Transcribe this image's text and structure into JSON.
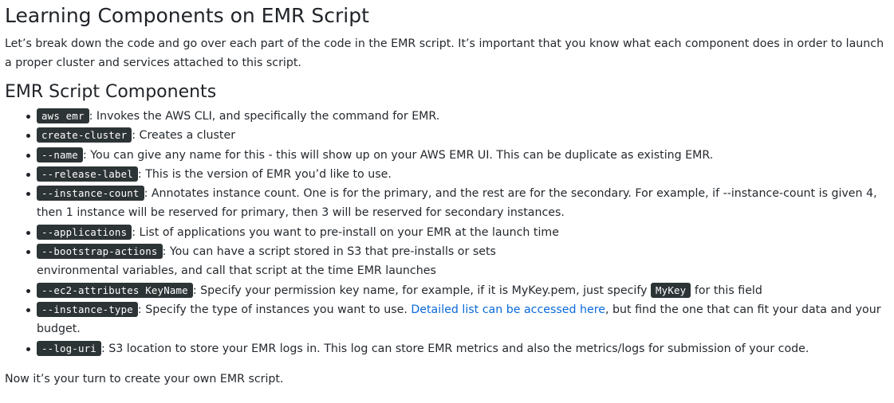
{
  "title": "Learning Components on EMR Script",
  "intro": "Let’s break down the code and go over each part of the code in the EMR script. It’s important that you know what each component does in order to launch a proper cluster and services attached to this script.",
  "section_title": "EMR Script Components",
  "items": [
    {
      "code": "aws emr",
      "text": ": Invokes the AWS CLI, and specifically the command for EMR."
    },
    {
      "code": "create-cluster",
      "text": ": Creates a cluster"
    },
    {
      "code": "--name",
      "text": ": You can give any name for this - this will show up on your AWS EMR UI. This can be duplicate as existing EMR."
    },
    {
      "code": "--release-label",
      "text": ": This is the version of EMR you’d like to use."
    },
    {
      "code": "--instance-count",
      "text": ": Annotates instance count. One is for the primary, and the rest are for the secondary. For example, if --instance-count is given 4, then 1 instance will be reserved for primary, then 3 will be reserved for secondary instances."
    },
    {
      "code": "--applications",
      "text": ": List of applications you want to pre-install on your EMR at the launch time"
    },
    {
      "code": "--bootstrap-actions",
      "text": ": You can have a script stored in S3 that pre-installs or sets",
      "text_line2": "environmental variables, and call that script at the time EMR launches"
    },
    {
      "code": "--ec2-attributes KeyName",
      "text": ": Specify your permission key name, for example, if it is MyKey.pem, just specify ",
      "code2": "MyKey",
      "text_after": " for this field"
    },
    {
      "code": "--instance-type",
      "text": ": Specify the type of instances you want to use. ",
      "link": "Detailed list can be accessed here",
      "text_after": ", but find the one that can fit your data and your budget."
    },
    {
      "code": "--log-uri",
      "text": ": S3 location to store your EMR logs in. This log can store EMR metrics and also the metrics/logs for submission of your code."
    }
  ],
  "outro": "Now it’s your turn to create your own EMR script."
}
